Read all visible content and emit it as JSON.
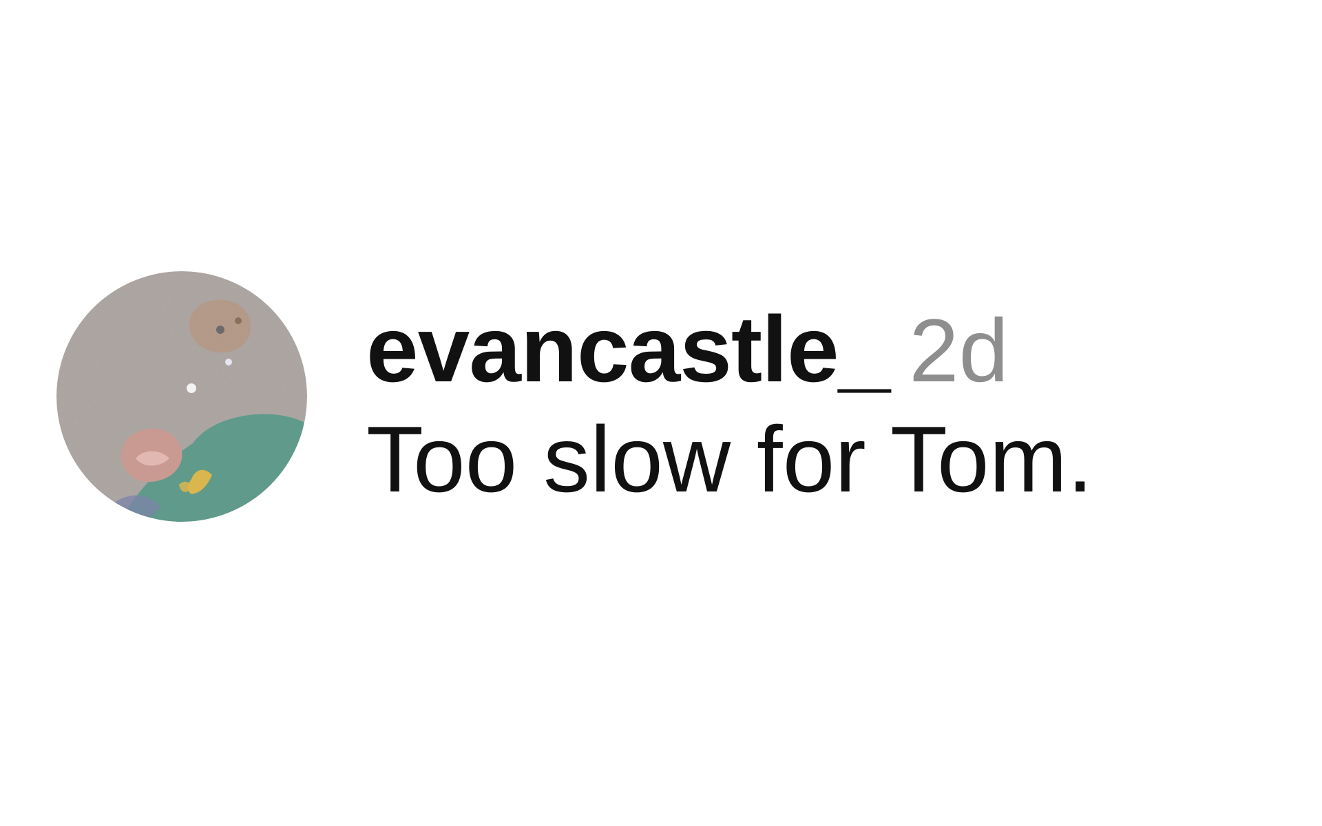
{
  "comment": {
    "avatar": {
      "icon": "user-avatar-photo",
      "colors": {
        "background": "#aaa39f",
        "jacket": "#5f9a8b",
        "accent": "#d9b64e"
      }
    },
    "username": "evancastle_",
    "timestamp": "2d",
    "text": "Too slow for Tom."
  },
  "colors": {
    "text_primary": "#111111",
    "text_secondary": "#8e8e8e",
    "background": "#ffffff"
  }
}
